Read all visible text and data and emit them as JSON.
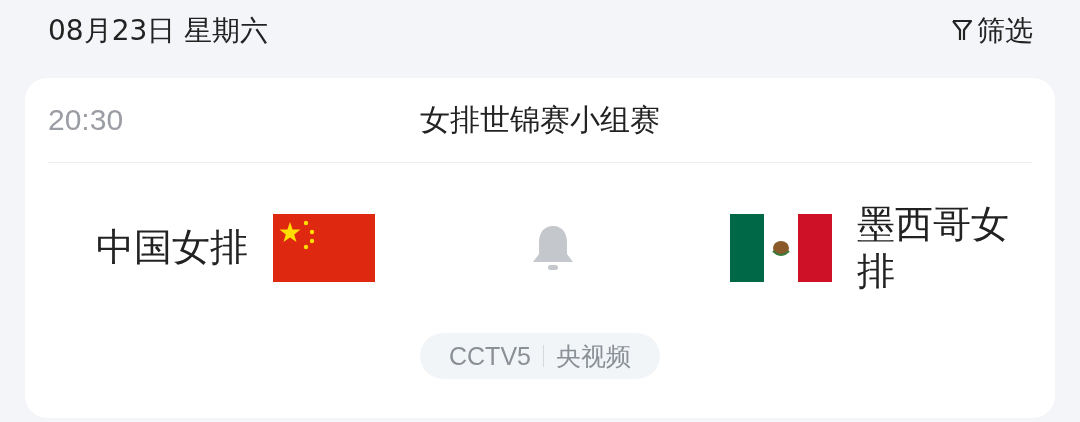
{
  "header": {
    "date": "08月23日 星期六",
    "filter_label": "筛选"
  },
  "match": {
    "time": "20:30",
    "event": "女排世锦赛小组赛",
    "home": {
      "name": "中国女排",
      "kind": "cn"
    },
    "away": {
      "name": "墨西哥女排",
      "kind": "mx"
    },
    "channels": [
      "CCTV5",
      "央视频"
    ]
  }
}
